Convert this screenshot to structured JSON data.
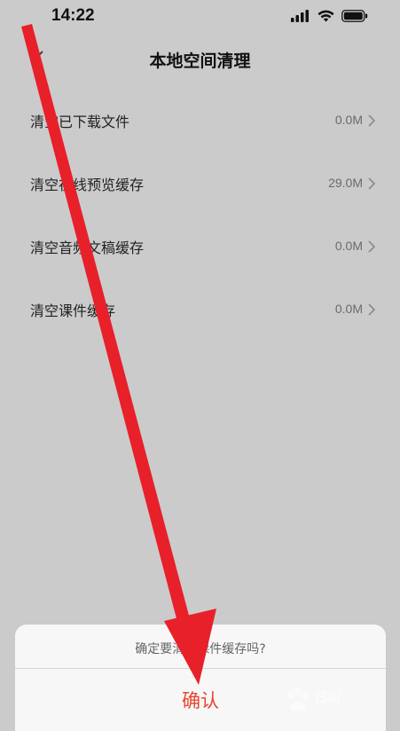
{
  "status_bar": {
    "time": "14:22"
  },
  "nav": {
    "title": "本地空间清理"
  },
  "list": {
    "items": [
      {
        "label": "清空已下载文件",
        "value": "0.0M"
      },
      {
        "label": "清空在线预览缓存",
        "value": "29.0M"
      },
      {
        "label": "清空音频文稿缓存",
        "value": "0.0M"
      },
      {
        "label": "清空课件缓存",
        "value": "0.0M"
      }
    ]
  },
  "dialog": {
    "message": "确定要清空课件缓存吗?",
    "confirm_label": "确认"
  },
  "watermark": {
    "text": "Bai"
  },
  "colors": {
    "confirm": "#e8442f",
    "arrow": "#e8202a",
    "overlay_bg": "#cbcbcb"
  },
  "icons": {
    "back": "chevron-left-icon",
    "chevron": "chevron-right-icon",
    "signal": "signal-icon",
    "wifi": "wifi-icon",
    "battery": "battery-icon"
  }
}
